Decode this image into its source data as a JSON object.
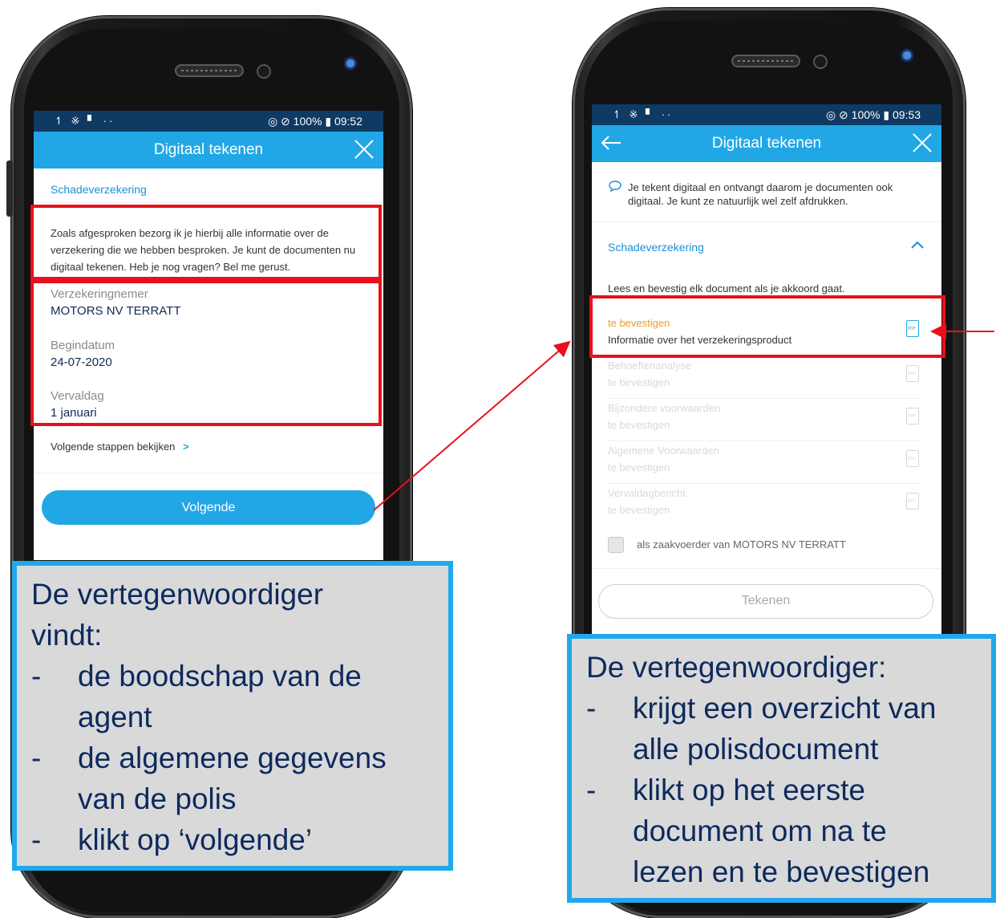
{
  "left_phone": {
    "status": {
      "left_icons": "↿ ※ ▘ ··",
      "right": "◎ ⊘ 100% ▮ 09:52"
    },
    "appbar": {
      "title": "Digitaal tekenen"
    },
    "section": "Schadeverzekering",
    "message": "Zoals afgesproken bezorg ik je hierbij alle informatie over de verzekering die we hebben besproken. Je kunt de documenten nu digitaal tekenen. Heb je nog vragen? Bel me gerust.",
    "fields": [
      {
        "label": "Verzekeringnemer",
        "value": "MOTORS NV TERRATT"
      },
      {
        "label": "Begindatum",
        "value": "24-07-2020"
      },
      {
        "label": "Vervaldag",
        "value": "1 januari"
      }
    ],
    "next_steps_link": "Volgende stappen bekijken",
    "next_button": "Volgende"
  },
  "right_phone": {
    "status": {
      "left_icons": "↿ ※ ▘ ··",
      "right": "◎ ⊘ 100% ▮ 09:53"
    },
    "appbar": {
      "title": "Digitaal tekenen"
    },
    "info": "Je tekent digitaal en ontvangt daarom je documenten ook digitaal. Je kunt ze natuurlijk wel zelf afdrukken.",
    "section": "Schadeverzekering",
    "instruction": "Lees en bevestig elk document als je akkoord gaat.",
    "active_doc": {
      "status": "te bevestigen",
      "name": "Informatie over het verzekeringsproduct"
    },
    "documents": [
      {
        "name": "Behoeftenanalyse",
        "status": "te bevestigen"
      },
      {
        "name": "Bijzondere voorwaarden",
        "status": "te bevestigen"
      },
      {
        "name": "Algemene Voorwaarden",
        "status": "te bevestigen"
      },
      {
        "name": "Vervaldagbericht",
        "status": "te bevestigen"
      }
    ],
    "checkbox_label": "als zaakvoerder van MOTORS NV TERRATT",
    "sign_button": "Tekenen"
  },
  "callout_left": {
    "head": "De vertegenwoordiger",
    "head2": "vindt:",
    "items": [
      [
        "de boodschap van de",
        "agent"
      ],
      [
        "de algemene gegevens",
        "van de polis"
      ],
      [
        "klikt op ‘volgende’"
      ]
    ]
  },
  "callout_right": {
    "head": "De vertegenwoordiger:",
    "items": [
      [
        "krijgt een overzicht van",
        "alle polisdocument"
      ],
      [
        "klikt op het eerste",
        "document om na te",
        "lezen en te bevestigen"
      ]
    ]
  },
  "colors": {
    "accent": "#22a7e6",
    "statusbar": "#0e3a63",
    "annotation_red": "#e8101d",
    "callout_border": "#1fa9ec"
  }
}
